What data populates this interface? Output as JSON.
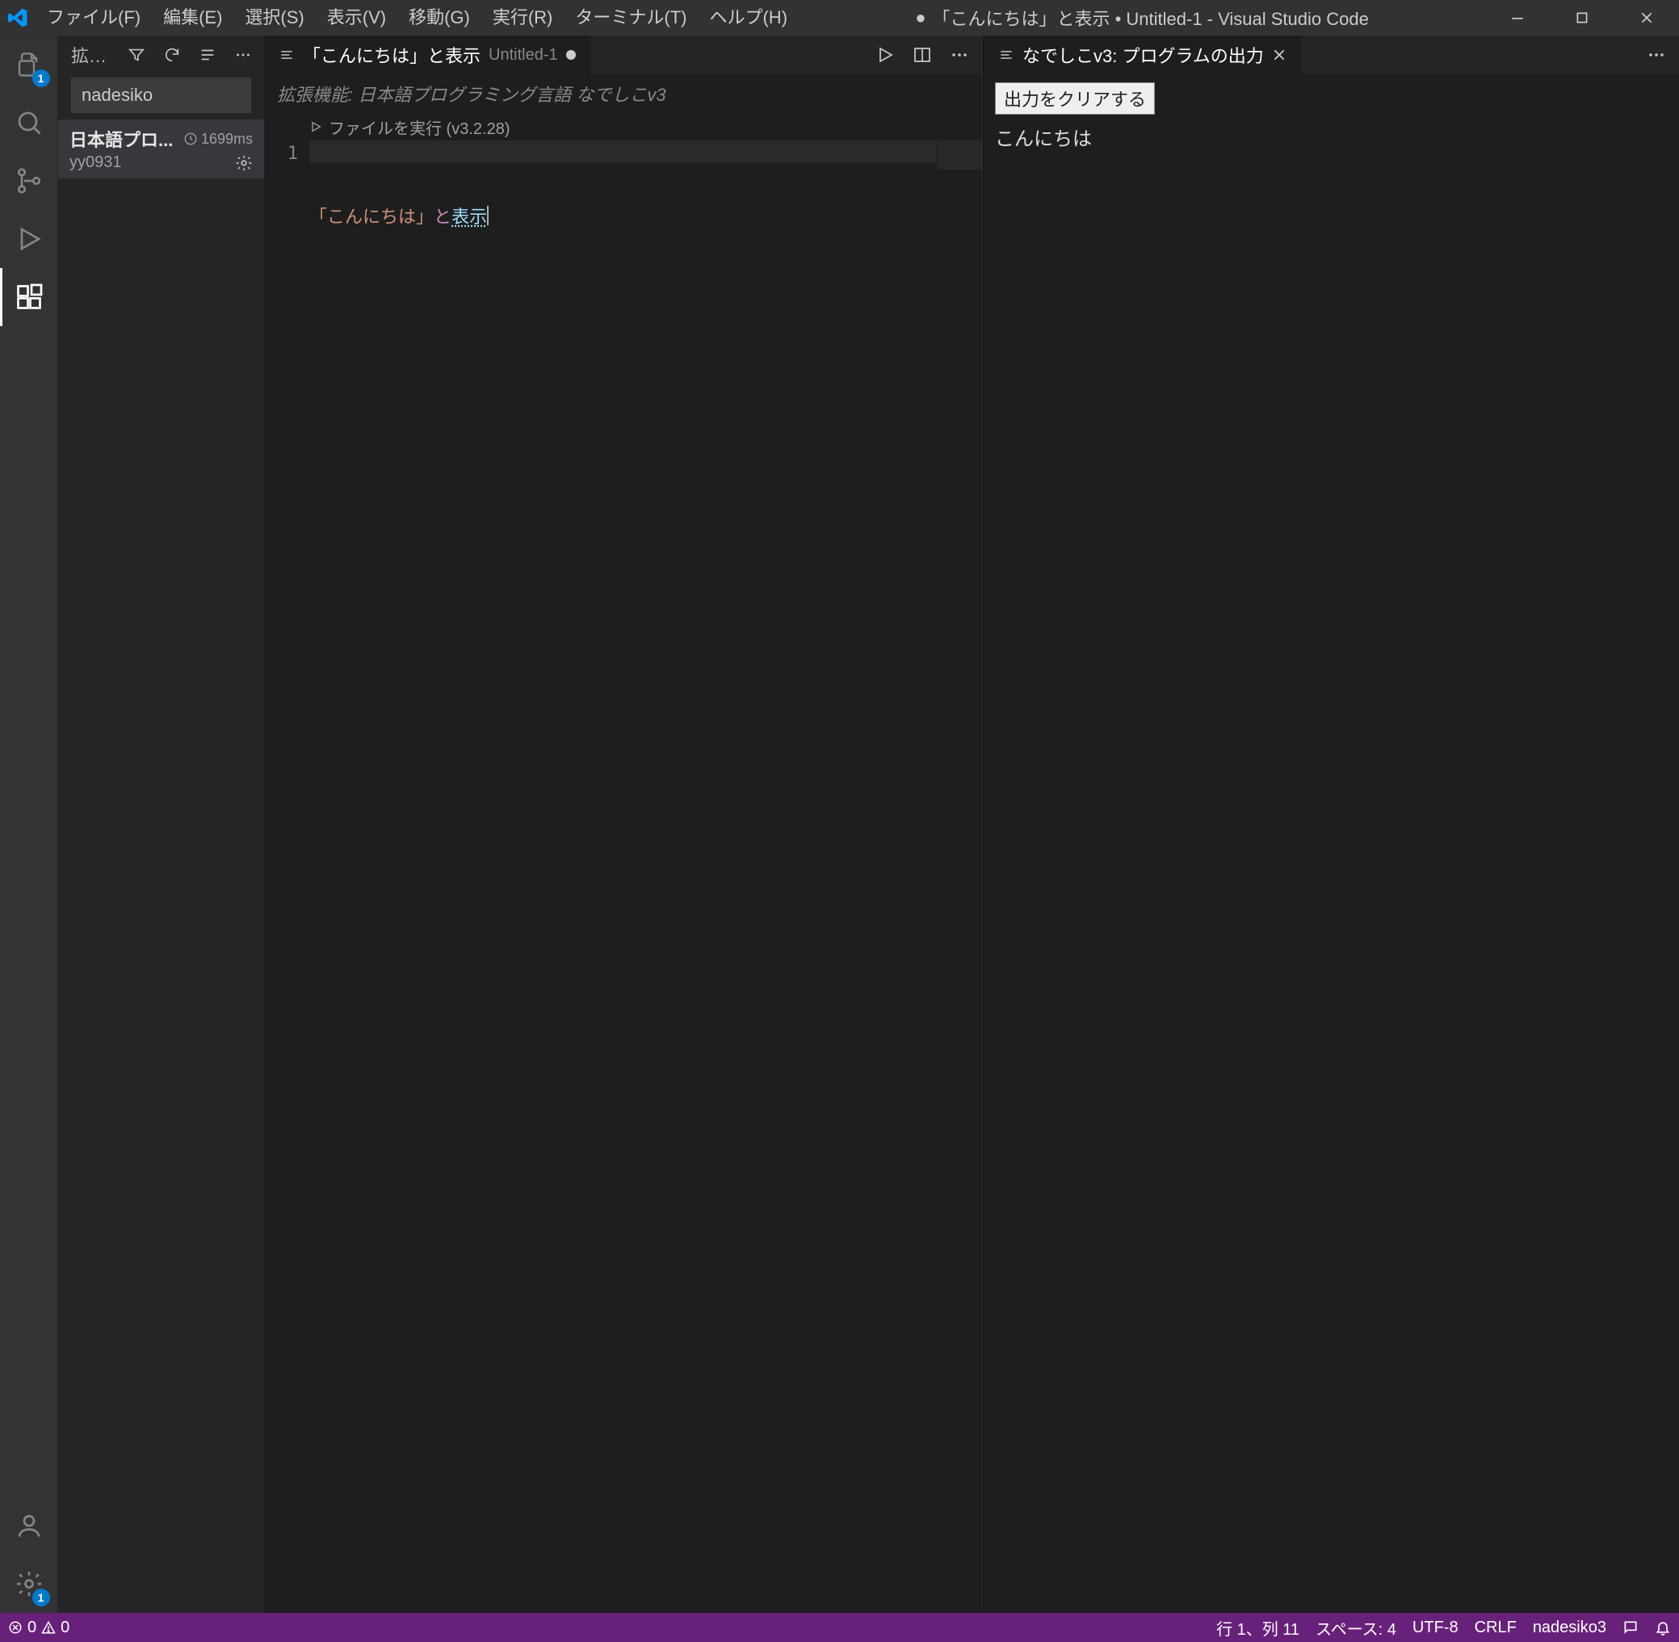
{
  "titlebar": {
    "title_prefix": "●",
    "title": "「こんにちは」と表示 • Untitled-1 - Visual Studio Code",
    "menu": [
      "ファイル(F)",
      "編集(E)",
      "選択(S)",
      "表示(V)",
      "移動(G)",
      "実行(R)",
      "ターミナル(T)",
      "ヘルプ(H)"
    ]
  },
  "activitybar": {
    "explorer_badge": "1",
    "settings_badge": "1"
  },
  "sidebar": {
    "header_label": "拡張...",
    "search_value": "nadesiko",
    "ext": {
      "name": "日本語プロ...",
      "time": "1699ms",
      "author": "yy0931"
    }
  },
  "left_group": {
    "ext_detail_tab": "拡張機能: 日本語プログラミング言語 なでしこv3",
    "code_tab_title": "「こんにちは」と表示",
    "code_tab_sub": "Untitled-1",
    "breadcrumb_label": "ファイルを実行 (v3.2.28)",
    "line_number": "1",
    "tok_open": "「",
    "tok_str": "こんにちは",
    "tok_close": "」",
    "tok_part": "と",
    "tok_verb": "表示"
  },
  "right_group": {
    "tab_title": "なでしこv3: プログラムの出力",
    "clear_button": "出力をクリアする",
    "output": "こんにちは"
  },
  "statusbar": {
    "errors": "0",
    "warnings": "0",
    "cursor": "行 1、列 11",
    "spaces": "スペース: 4",
    "encoding": "UTF-8",
    "eol": "CRLF",
    "language": "nadesiko3"
  }
}
